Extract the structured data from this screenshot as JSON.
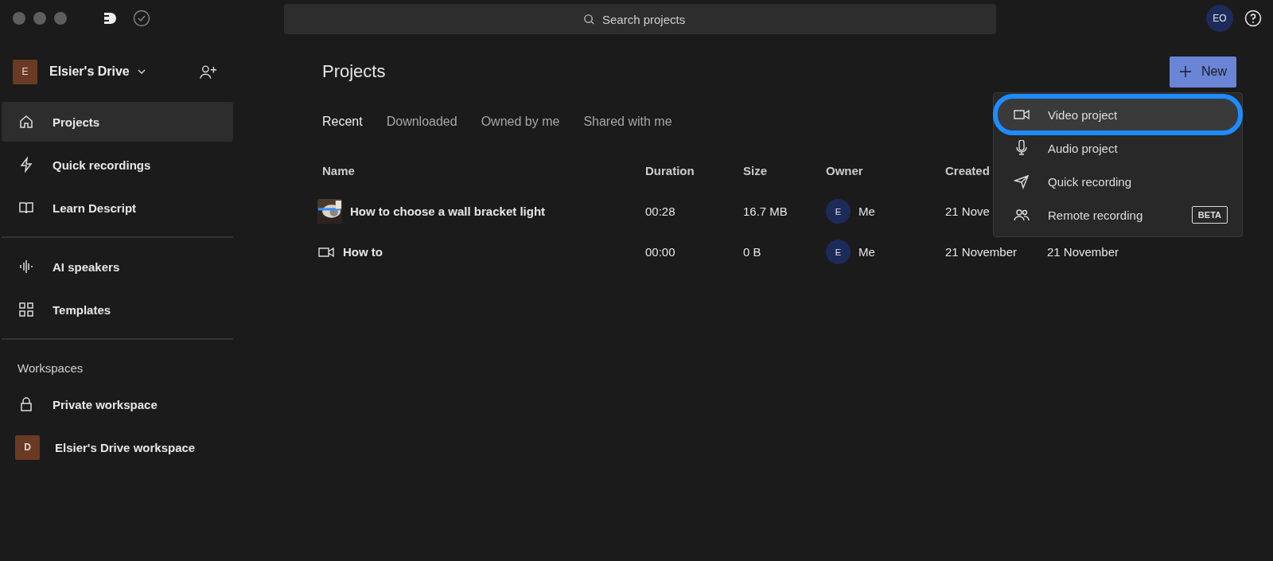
{
  "search": {
    "placeholder": "Search projects"
  },
  "user_avatar": "EO",
  "drive": {
    "initial": "E",
    "name": "Elsier's Drive"
  },
  "nav": [
    {
      "label": "Projects",
      "selected": true
    },
    {
      "label": "Quick recordings",
      "selected": false
    },
    {
      "label": "Learn Descript",
      "selected": false
    },
    {
      "label": "AI speakers",
      "selected": false
    },
    {
      "label": "Templates",
      "selected": false
    }
  ],
  "workspaces": {
    "title": "Workspaces",
    "items": [
      {
        "kind": "lock",
        "label": "Private workspace",
        "selected": false
      },
      {
        "kind": "avatar",
        "initial": "D",
        "label": "Elsier's Drive workspace",
        "selected": false
      }
    ]
  },
  "page_title": "Projects",
  "new_button": "New",
  "tabs": [
    {
      "label": "Recent",
      "selected": true
    },
    {
      "label": "Downloaded",
      "selected": false
    },
    {
      "label": "Owned by me",
      "selected": false
    },
    {
      "label": "Shared with me",
      "selected": false
    }
  ],
  "table": {
    "columns": [
      "Name",
      "Duration",
      "Size",
      "Owner",
      "Created"
    ],
    "rows": [
      {
        "kind": "picture",
        "name": "How to choose a wall bracket light",
        "duration": "00:28",
        "size": "16.7 MB",
        "owner_initial": "E",
        "owner": "Me",
        "created": "21 Nove"
      },
      {
        "kind": "video",
        "name": "How to",
        "duration": "00:00",
        "size": "0 B",
        "owner_initial": "E",
        "owner": "Me",
        "created": "21 November",
        "column_6": "21 November"
      }
    ]
  },
  "new_menu": [
    {
      "label": "Video project",
      "selected": true
    },
    {
      "label": "Audio project",
      "selected": false
    },
    {
      "label": "Quick recording",
      "selected": false
    },
    {
      "label": "Remote recording",
      "selected": false,
      "badge": "BETA"
    }
  ]
}
